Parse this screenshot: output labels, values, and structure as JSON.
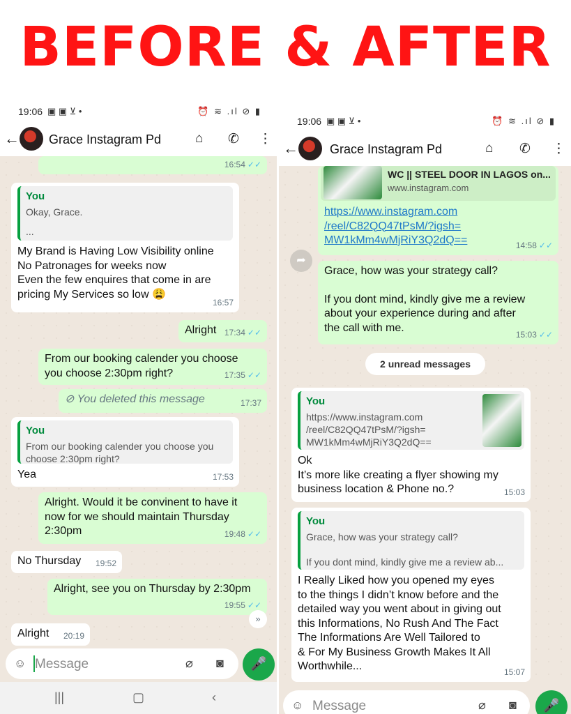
{
  "banner": "BEFORE & AFTER",
  "before": {
    "status_time": "19:06",
    "status_left_icons": "▣ ▣ ⊻ •",
    "status_right_icons": "⏰ ≋ .ıl ⊘ ▮",
    "contact_name": "Grace Instagram Pd",
    "messages": {
      "m0_time": "16:54",
      "m1_quote_name": "You",
      "m1_quote_text": "Okay, Grace.",
      "m1_quote_more": "...",
      "m1_l1": "My Brand is Having Low Visibility online",
      "m1_l2": "No Patronages for weeks now",
      "m1_l3": "Even the few enquires that come in are",
      "m1_l4": "pricing My Services so low 😩",
      "m1_time": "16:57",
      "m2_text": "Alright",
      "m2_time": "17:34",
      "m3_l1": "From our booking calender you choose",
      "m3_l2": "you choose 2:30pm right?",
      "m3_time": "17:35",
      "m4_text": "You deleted this message",
      "m4_time": "17:37",
      "m5_quote_name": "You",
      "m5_quote_l1": "From our booking calender you choose you",
      "m5_quote_l2": "choose 2:30pm right?",
      "m5_text": "Yea",
      "m5_time": "17:53",
      "m6_l1": "Alright. Would it be convinent to have it",
      "m6_l2": "now for we should maintain Thursday",
      "m6_l3": "2:30pm",
      "m6_time": "19:48",
      "m7_text": "No Thursday",
      "m7_time": "19:52",
      "m8_text": "Alright, see you on Thursday by 2:30pm",
      "m8_time": "19:55",
      "m9_text": "Alright",
      "m9_time": "20:19"
    },
    "input_placeholder": "Message"
  },
  "after": {
    "status_time": "19:06",
    "status_left_icons": "▣ ▣ ⊻ •",
    "status_right_icons": "⏰ ≋ .ıl ⊘ ▮",
    "contact_name": "Grace Instagram Pd",
    "messages": {
      "m1_preview_title": "WC || STEEL DOOR IN LAGOS on...",
      "m1_preview_site": "www.instagram.com",
      "m1_link_l1": "https://www.instagram.com",
      "m1_link_l2": "/reel/C82QQ47tPsM/?igsh=",
      "m1_link_l3": "MW1kMm4wMjRiY3Q2dQ==",
      "m1_time": "14:58",
      "m2_l1": "Grace, how was your strategy call?",
      "m2_l2": "If you dont mind, kindly give me a review",
      "m2_l3": "about your experience during and after",
      "m2_l4": "the call with me.",
      "m2_time": "15:03",
      "unread": "2 unread messages",
      "m3_quote_name": "You",
      "m3_quote_l1": "https://www.instagram.com",
      "m3_quote_l2": "/reel/C82QQ47tPsM/?igsh=",
      "m3_quote_l3": "MW1kMm4wMjRiY3Q2dQ==",
      "m3_l1": "Ok",
      "m3_l2": "It’s more like creating a flyer showing my",
      "m3_l3": "business location & Phone no.?",
      "m3_time": "15:03",
      "m4_quote_name": "You",
      "m4_quote_l1": "Grace, how was your strategy call?",
      "m4_quote_l2": "If you dont mind, kindly give me a review ab...",
      "m4_l1": "I Really Liked how you opened my eyes",
      "m4_l2": "to the things I didn’t know before and the",
      "m4_l3": "detailed way you went about in giving out",
      "m4_l4": "this Informations, No Rush And The Fact",
      "m4_l5": "The Informations Are Well Tailored to",
      "m4_l6": "& For My Business Growth Makes It All",
      "m4_l7": "Worthwhile...",
      "m4_time": "15:07"
    },
    "input_placeholder": "Message"
  },
  "icons": {
    "back": "back-arrow-icon",
    "store": "store-icon",
    "add_call": "add-call-icon",
    "menu": "more-vert-icon",
    "emoji": "emoji-icon",
    "attach": "paperclip-icon",
    "camera": "camera-icon",
    "mic": "mic-icon"
  },
  "colors": {
    "banner": "#ff1414",
    "outgoing": "#d9fdd3",
    "incoming": "#ffffff",
    "accent_green": "#1aa74a",
    "read_tick": "#53bdeb",
    "chat_bg": "#efe7de"
  }
}
